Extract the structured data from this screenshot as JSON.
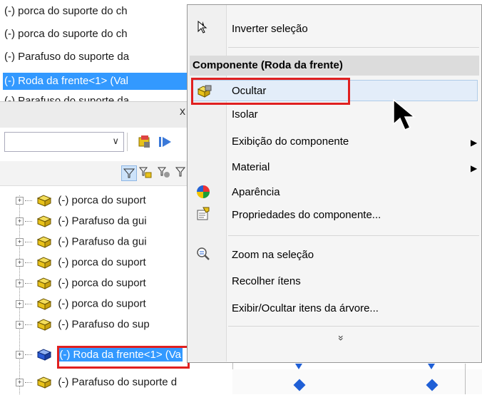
{
  "tree_top": {
    "rows": [
      {
        "label": "(-) porca do suporte do ch",
        "selected": false
      },
      {
        "label": "(-) porca do suporte do ch",
        "selected": false
      },
      {
        "label": "(-) Parafuso do suporte da",
        "selected": false
      },
      {
        "label": "(-) Roda da frente<1> (Val",
        "selected": true
      },
      {
        "label": "(-) Parafuso do suporte da",
        "selected": false
      }
    ]
  },
  "panel": {
    "close_label": "x",
    "combo_value": "",
    "combo_arrow": "∨"
  },
  "tree": {
    "rows": [
      {
        "label": "(-) porca do suport"
      },
      {
        "label": "(-) Parafuso da gui"
      },
      {
        "label": "(-) Parafuso da gui"
      },
      {
        "label": "(-) porca do suport"
      },
      {
        "label": "(-) porca do suport"
      },
      {
        "label": "(-) porca do suport"
      },
      {
        "label": "(-) Parafuso do sup"
      },
      {
        "label": "(-) Roda da frente<1> (Va"
      },
      {
        "label": "(-) Parafuso do suporte d"
      }
    ],
    "plus_symbol": "+"
  },
  "menu": {
    "invert_label": "Inverter seleção",
    "section_header": "Componente (Roda da frente)",
    "hide_label": "Ocultar",
    "isolate_label": "Isolar",
    "display_label": "Exibição do componente",
    "material_label": "Material",
    "appearance_label": "Aparência",
    "properties_label": "Propriedades do componente...",
    "zoom_label": "Zoom na seleção",
    "collapse_label": "Recolher ítens",
    "show_hide_tree_label": "Exibir/Ocultar itens da árvore...",
    "more_symbol": "»",
    "submenu_arrow": "▶"
  },
  "colors": {
    "selection": "#3399ff",
    "highlight_border": "#e02020",
    "menu_hover": "#e3edf9",
    "part_icon_yellow": "#e8c21a",
    "part_icon_blue": "#2a5bd7"
  },
  "icons": [
    "cursor-select-icon",
    "part-cube-icon",
    "appearance-ball-icon",
    "properties-icon",
    "zoom-selection-icon",
    "mouse-pointer-icon"
  ]
}
